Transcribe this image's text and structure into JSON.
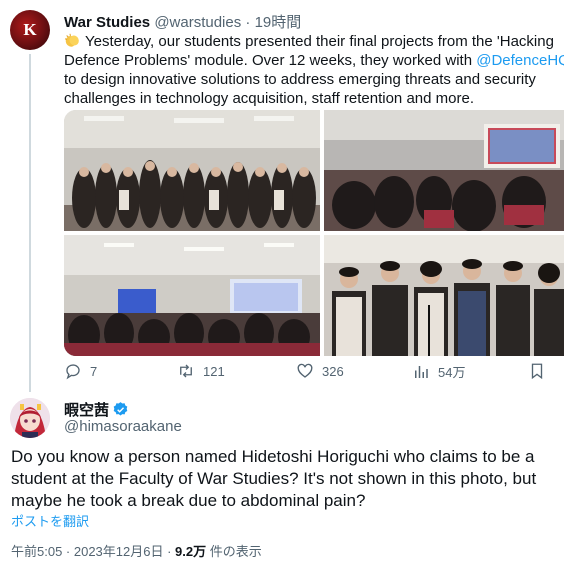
{
  "quoted_tweet": {
    "avatar_letter": "K",
    "author_name": "War Studies",
    "author_handle": "@warstudies",
    "separator": "·",
    "time_ago": "19時間",
    "body_lines": [
      {
        "text": "Yesterday, our students presented their final projects from the 'Hacking"
      },
      {
        "text": "Defence Problems' module. Over 12 weeks, they worked with ",
        "mention": "@DefenceHQ"
      },
      {
        "text": "to design innovative solutions to address emerging threats and security"
      },
      {
        "text": "challenges in technology acquisition, staff retention and more."
      }
    ],
    "clap_emoji": "clapping-hands",
    "stats": {
      "replies": "7",
      "retweets": "121",
      "likes": "326",
      "views": "54万"
    }
  },
  "reply": {
    "author_name": "暇空茜",
    "author_handle": "@himasoraakane",
    "body_lines": [
      "Do you know a person named Hidetoshi Horiguchi who claims to be a",
      "student at the Faculty of War Studies? It's not shown in this photo, but",
      "maybe he took a break due to abdominal pain?"
    ],
    "translate_label": "ポストを翻訳",
    "timestamp": "午前5:05 · 2023年12月6日 · ",
    "views_count": "9.2万",
    "views_label": " 件の表示"
  },
  "colors": {
    "accent": "#1d9bf0",
    "text": "#0f1419",
    "muted": "#536471",
    "verified": "#1d9bf0"
  }
}
